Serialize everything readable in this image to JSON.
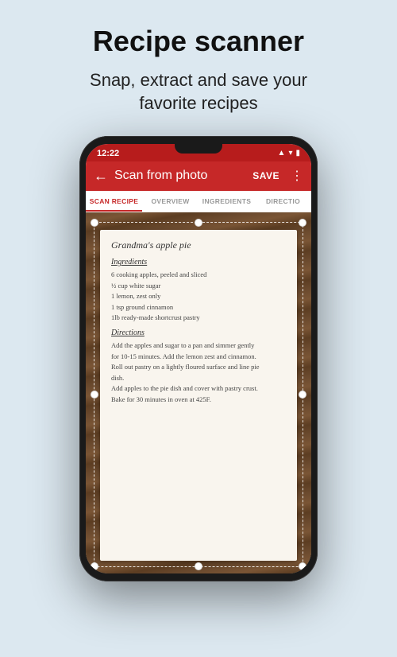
{
  "header": {
    "title": "Recipe scanner",
    "subtitle_line1": "Snap, extract and save your",
    "subtitle_line2": "favorite recipes"
  },
  "phone": {
    "status_bar": {
      "time": "12:22",
      "icons": [
        "signal",
        "wifi",
        "battery"
      ]
    },
    "app_bar": {
      "title": "Scan from photo",
      "save_label": "SAVE",
      "back_icon": "←",
      "more_icon": "⋮"
    },
    "tabs": [
      {
        "label": "SCAN RECIPE",
        "active": true
      },
      {
        "label": "OVERVIEW",
        "active": false
      },
      {
        "label": "INGREDIENTS",
        "active": false
      },
      {
        "label": "DIRECTIO",
        "active": false
      }
    ],
    "recipe": {
      "title": "Grandma's apple pie",
      "ingredients_label": "Ingredients",
      "ingredients": [
        "6 cooking apples, peeled and sliced",
        "½ cup white sugar",
        "1 lemon, zest only",
        "1 tsp ground cinnamon",
        "1lb ready-made shortcrust pastry"
      ],
      "directions_label": "Directions",
      "directions": [
        "Add the apples and sugar to a pan and simmer gently",
        "for 10-15 minutes. Add the lemon zest and cinnamon.",
        "Roll out pastry on a lightly floured surface and line pie",
        "dish.",
        "Add apples to the pie dish and cover with pastry crust.",
        "Bake for 30 minutes in oven at 425F."
      ]
    }
  },
  "colors": {
    "background": "#dce8f0",
    "app_bar": "#c62828",
    "tab_active": "#c62828",
    "title_text": "#111111",
    "subtitle_text": "#222222"
  }
}
